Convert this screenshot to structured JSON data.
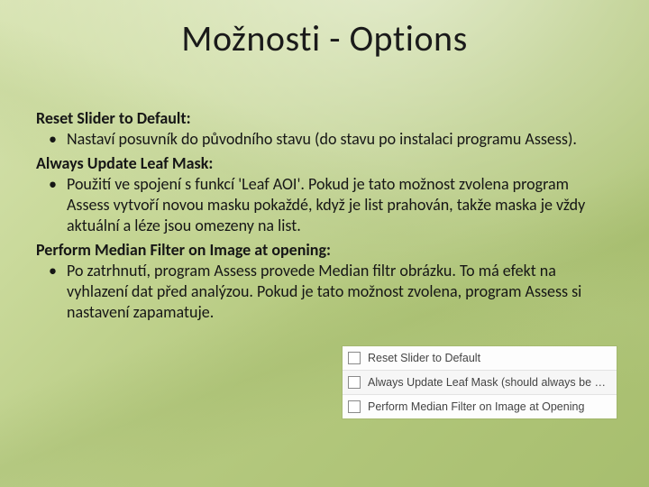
{
  "title": "Možnosti - Options",
  "sections": [
    {
      "heading": "Reset Slider to Default:",
      "bullet": "Nastaví posuvník do původního stavu (do stavu po instalaci programu Assess)."
    },
    {
      "heading": "Always Update Leaf Mask:",
      "bullet": "Použití ve spojení s funkcí 'Leaf AOI'. Pokud je tato možnost zvolena program Assess vytvoří novou masku pokaždé, když je list prahován, takže maska je vždy aktuální a léze jsou omezeny na list."
    },
    {
      "heading": "Perform Median Filter on Image at opening:",
      "bullet": "Po zatrhnutí, program Assess provede Median filtr obrázku. To má efekt na vyhlazení dat před analýzou.  Pokud je tato možnost zvolena, program Assess si nastavení zapamatuje."
    }
  ],
  "options_panel": {
    "rows": [
      {
        "label": "Reset Slider to Default"
      },
      {
        "label": "Always Update Leaf Mask (should always be checked)"
      },
      {
        "label": "Perform Median Filter on Image at Opening"
      }
    ]
  }
}
